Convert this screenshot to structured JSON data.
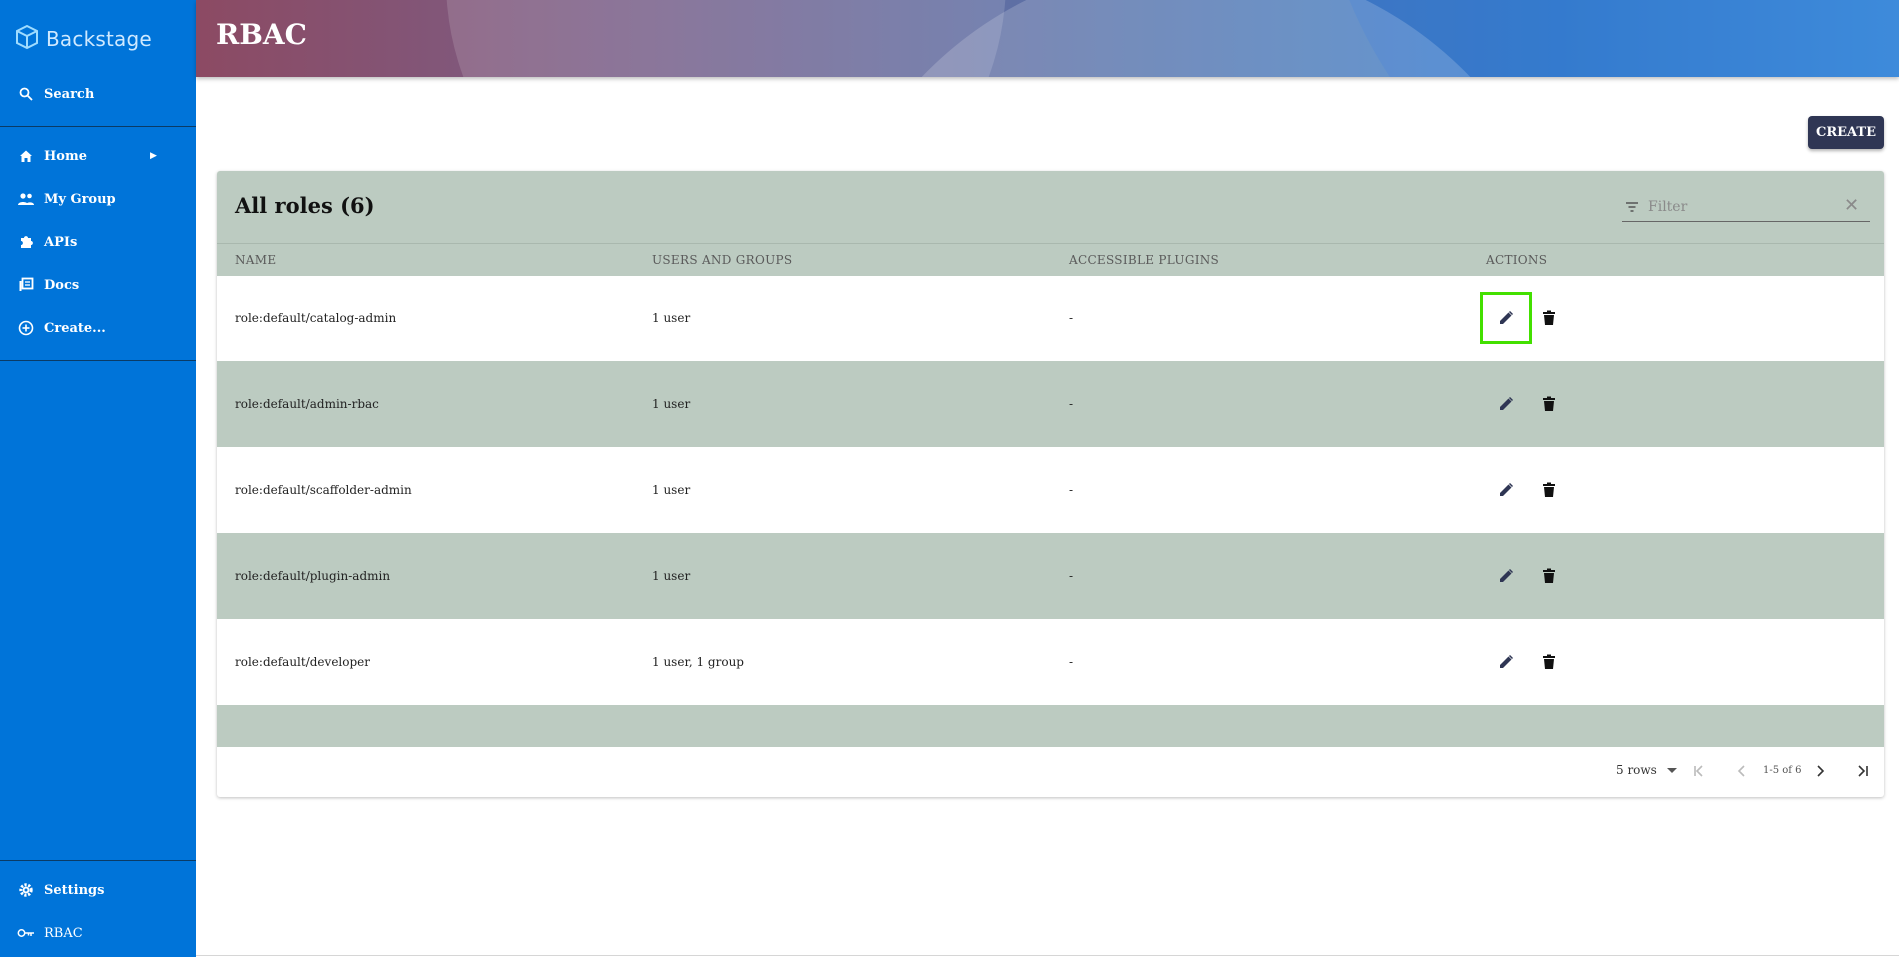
{
  "sidebar": {
    "brand": "Backstage",
    "search": "Search",
    "items": [
      {
        "label": "Home",
        "icon": "home-icon"
      },
      {
        "label": "My Group",
        "icon": "group-icon"
      },
      {
        "label": "APIs",
        "icon": "puzzle-icon"
      },
      {
        "label": "Docs",
        "icon": "library-icon"
      },
      {
        "label": "Create...",
        "icon": "add-circle-icon"
      }
    ],
    "settings": "Settings",
    "rbac": "RBAC"
  },
  "header": {
    "title": "RBAC"
  },
  "create_button": "CREATE",
  "table": {
    "title": "All roles (6)",
    "filter_placeholder": "Filter",
    "columns": [
      "NAME",
      "USERS AND GROUPS",
      "ACCESSIBLE PLUGINS",
      "ACTIONS"
    ],
    "rows": [
      {
        "name": "role:default/catalog-admin",
        "users": "1 user",
        "plugins": "-"
      },
      {
        "name": "role:default/admin-rbac",
        "users": "1 user",
        "plugins": "-"
      },
      {
        "name": "role:default/scaffolder-admin",
        "users": "1 user",
        "plugins": "-"
      },
      {
        "name": "role:default/plugin-admin",
        "users": "1 user",
        "plugins": "-"
      },
      {
        "name": "role:default/developer",
        "users": "1 user, 1 group",
        "plugins": "-"
      }
    ],
    "pagination": {
      "rows_per_page": "5 rows",
      "info": "1-5 of 6"
    }
  },
  "colors": {
    "sidebar": "#0074d9",
    "table_stripe": "#bccbc1",
    "primary_button": "#2f3654",
    "highlight": "#43e000"
  }
}
